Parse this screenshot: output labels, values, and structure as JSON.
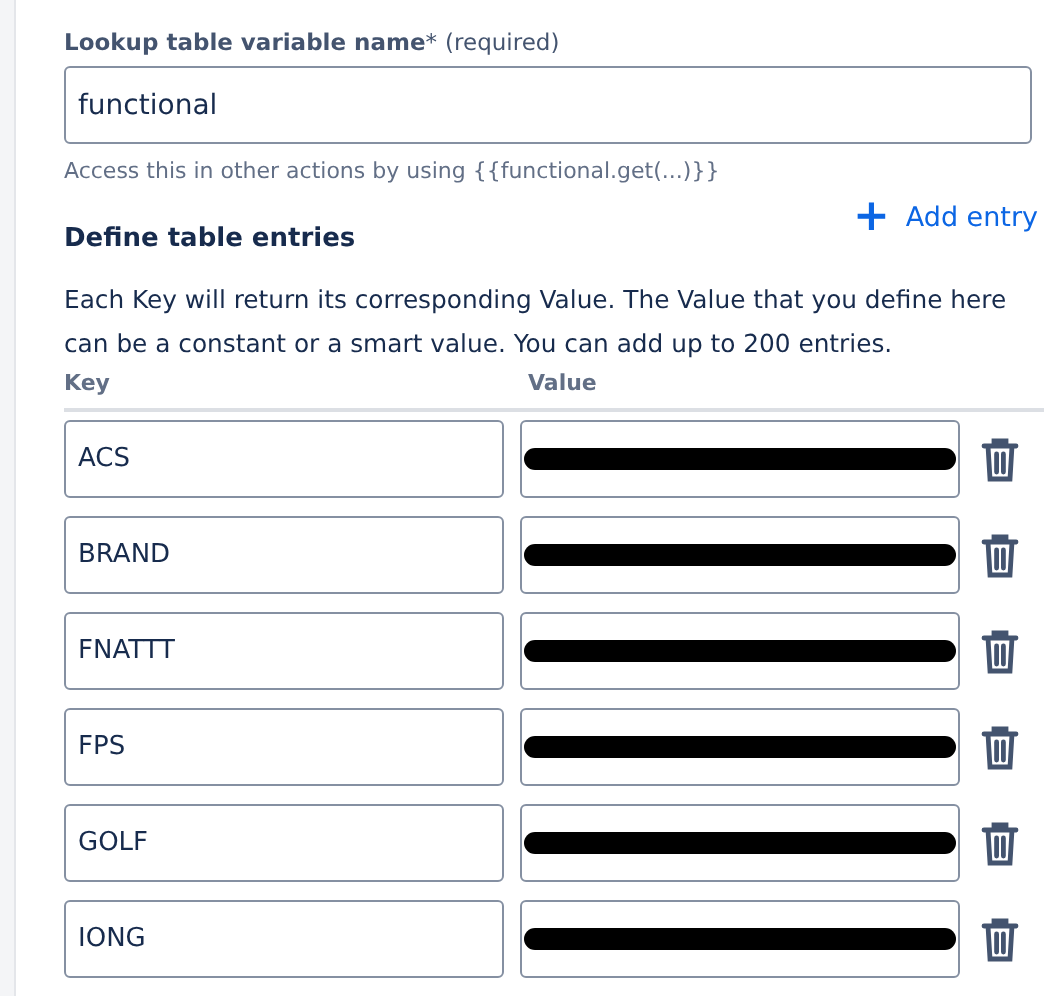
{
  "name_field": {
    "label": "Lookup table variable name",
    "required_mark": "*",
    "required_note": "(required)",
    "value": "functional",
    "helper": "Access this in other actions by using {{functional.get(...)}}"
  },
  "entries_section": {
    "title": "Define table entries",
    "add_button": {
      "icon": "+",
      "label": "Add entry"
    },
    "description": "Each Key will return its corresponding Value. The Value that you define here can be a constant or a smart value. You can add up to 200 entries.",
    "columns": [
      "Key",
      "Value"
    ],
    "rows": [
      {
        "key": "ACS",
        "value_redacted": true
      },
      {
        "key": "BRAND",
        "value_redacted": true
      },
      {
        "key": "FNATTT",
        "value_redacted": true
      },
      {
        "key": "FPS",
        "value_redacted": true
      },
      {
        "key": "GOLF",
        "value_redacted": true
      },
      {
        "key": "IONG",
        "value_redacted": true
      }
    ]
  }
}
